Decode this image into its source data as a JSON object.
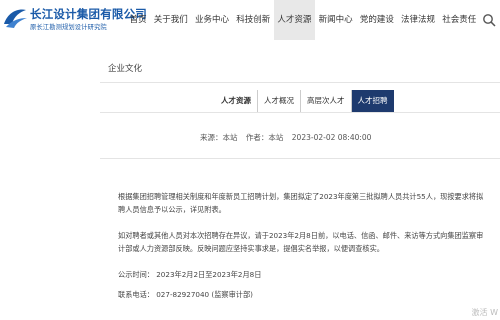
{
  "header": {
    "logo_cn": "长江设计集团有限公司",
    "logo_sub": "原长江勘测规划设计研究院",
    "nav": [
      {
        "label": "首页",
        "active": false
      },
      {
        "label": "关于我们",
        "active": false
      },
      {
        "label": "业务中心",
        "active": false
      },
      {
        "label": "科技创新",
        "active": false
      },
      {
        "label": "人才资源",
        "active": true
      },
      {
        "label": "新闻中心",
        "active": false
      },
      {
        "label": "党的建设",
        "active": false
      },
      {
        "label": "法律法规",
        "active": false
      },
      {
        "label": "社会责任",
        "active": false
      }
    ],
    "search_icon": "search-icon"
  },
  "section": {
    "title": "企业文化"
  },
  "subtabs": [
    {
      "label": "人才资源",
      "active": false
    },
    {
      "label": "人才概况",
      "active": false
    },
    {
      "label": "高层次人才",
      "active": false
    },
    {
      "label": "人才招聘",
      "active": true
    }
  ],
  "meta": {
    "source": "来源：本站",
    "author": "作者：本站",
    "time": "2023-02-02 08:40:00"
  },
  "article": {
    "p1": "根据集团招聘管理相关制度和年度新员工招聘计划，集团拟定了2023年度第三批拟聘人员共计55人，现按要求将拟聘人员信息予以公示，详见附表。",
    "p2": "如对聘者或其他人员对本次招聘存在异议，请于2023年2月8日前，以电话、信函、邮件、来访等方式向集团监察审计部或人力资源部反映。反映问题应坚持实事求是，提倡实名举报，以便调查核实。",
    "period": "公示时间：  2023年2月2日至2023年2月8日",
    "contact": "联系电话：  027-82927040  (监察审计部)"
  },
  "watermark": "激活 W"
}
